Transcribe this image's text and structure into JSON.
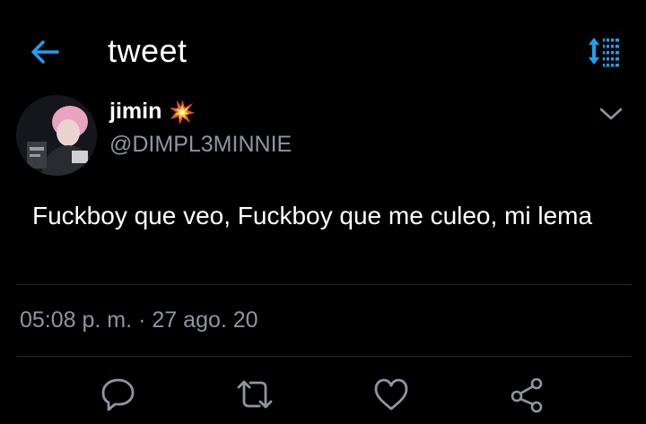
{
  "header": {
    "title": "tweet",
    "back_icon": "arrow-left-icon",
    "sort_icon": "sort-icon",
    "accent_color": "#1da1f2"
  },
  "tweet": {
    "author_name": "jimin",
    "author_emoji_icon": "collision-emoji-icon",
    "handle": "@DIMPL3MINNIE",
    "text": "Fuckboy que veo, Fuckboy que me culeo, mi lema",
    "time": "05:08 p. m.",
    "separator": "·",
    "date": "27 ago. 20"
  },
  "actions": {
    "icons": [
      "reply-icon",
      "retweet-icon",
      "like-icon",
      "share-icon"
    ],
    "icon_color": "#8a97a3"
  }
}
